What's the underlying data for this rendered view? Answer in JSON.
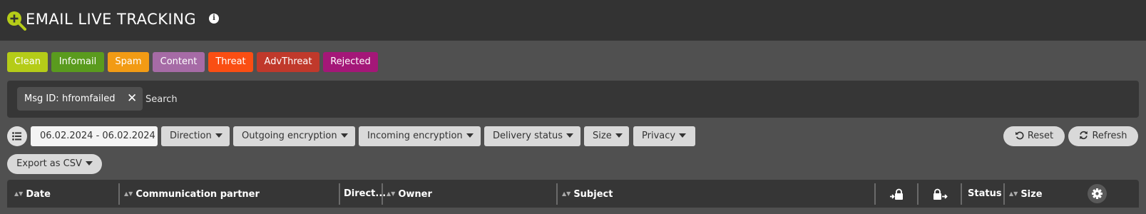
{
  "header": {
    "title": "EMAIL LIVE TRACKING",
    "info_glyph": "i"
  },
  "categories": [
    {
      "label": "Clean",
      "color": "#b5cc18"
    },
    {
      "label": "Infomail",
      "color": "#5a9b1e"
    },
    {
      "label": "Spam",
      "color": "#f29b14"
    },
    {
      "label": "Content",
      "color": "#a66ba6"
    },
    {
      "label": "Threat",
      "color": "#fa4e13"
    },
    {
      "label": "AdvThreat",
      "color": "#c0392b"
    },
    {
      "label": "Rejected",
      "color": "#a41778"
    }
  ],
  "search": {
    "tag_key": "Msg ID:",
    "tag_value": "hfromfailed",
    "tag_close": "✕",
    "placeholder": "Search"
  },
  "filters": {
    "date_range": "06.02.2024 - 06.02.2024",
    "direction": "Direction",
    "outgoing_encryption": "Outgoing encryption",
    "incoming_encryption": "Incoming encryption",
    "delivery_status": "Delivery status",
    "size": "Size",
    "privacy": "Privacy",
    "reset": "Reset",
    "refresh": "Refresh",
    "export": "Export as CSV"
  },
  "table": {
    "columns": {
      "date": "Date",
      "partner": "Communication partner",
      "direction": "Direct...",
      "owner": "Owner",
      "subject": "Subject",
      "status": "Status",
      "size": "Size"
    }
  },
  "icons": {
    "logo": "add-search-icon",
    "list": "list-icon",
    "reset": "undo-icon",
    "refresh": "refresh-icon",
    "incoming_lock": "lock-in-icon",
    "outgoing_lock": "lock-out-icon",
    "settings": "gear-icon"
  }
}
